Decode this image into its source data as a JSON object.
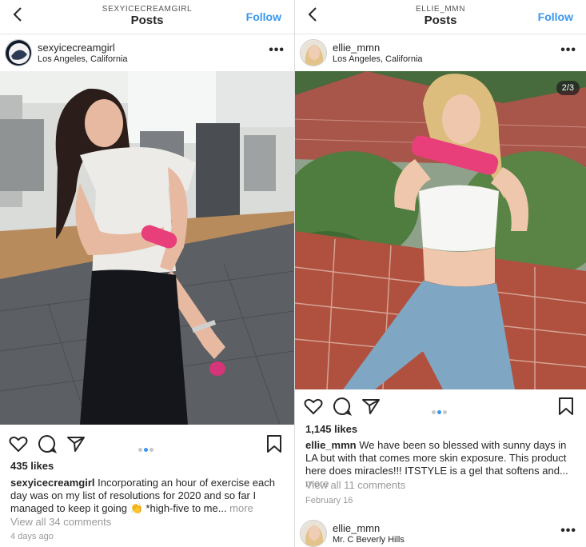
{
  "left": {
    "topbar": {
      "username": "SEXYICECREAMGIRL",
      "title": "Posts",
      "follow": "Follow"
    },
    "post": {
      "username": "sexyicecreamgirl",
      "location": "Los Angeles, California",
      "more": "•••",
      "likes": "435 likes",
      "caption_user": "sexyicecreamgirl",
      "caption_text": " Incorporating an hour of exercise each day was on my list of resolutions for 2020 and so far I managed to keep it going 👏 *high-five to me...",
      "caption_more": " more",
      "view_comments": "View all 34 comments",
      "time": "4 days ago",
      "carousel_active": 2,
      "carousel_total": 3
    }
  },
  "right": {
    "topbar": {
      "username": "ELLIE_MMN",
      "title": "Posts",
      "follow": "Follow"
    },
    "post": {
      "username": "ellie_mmn",
      "location": "Los Angeles, California",
      "more": "•••",
      "counter": "2/3",
      "likes": "1,145 likes",
      "caption_user": "ellie_mmn",
      "caption_text": " We have been so blessed with sunny days in LA but with that comes more skin exposure. This product here does miracles!!! ITSTYLE is a gel that softens and...",
      "caption_more": " more",
      "view_comments": "View all 11 comments",
      "time": "February 16",
      "carousel_active": 2,
      "carousel_total": 3
    },
    "next_post": {
      "username": "ellie_mmn",
      "location": "Mr. C Beverly Hills",
      "more": "•••"
    }
  },
  "colors": {
    "accent": "#3897f0",
    "text": "#262626",
    "muted": "#999999",
    "product_pink": "#e83f7b"
  },
  "icons": [
    "chevron-left-icon",
    "more-icon",
    "heart-icon",
    "comment-icon",
    "share-icon",
    "bookmark-icon"
  ]
}
